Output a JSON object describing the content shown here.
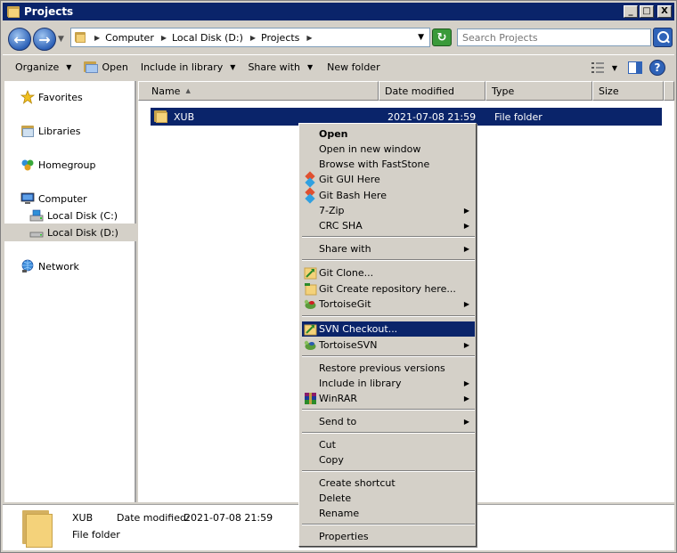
{
  "window": {
    "title": "Projects"
  },
  "titlebar_buttons": {
    "minimize": "_",
    "maximize": "□",
    "close": "X"
  },
  "address": {
    "crumbs": [
      "Computer",
      "Local Disk (D:)",
      "Projects"
    ],
    "search_placeholder": "Search Projects"
  },
  "toolbar": {
    "organize": "Organize",
    "open": "Open",
    "include_in_library": "Include in library",
    "share_with": "Share with",
    "new_folder": "New folder"
  },
  "nav": {
    "favorites": "Favorites",
    "libraries": "Libraries",
    "homegroup": "Homegroup",
    "computer": "Computer",
    "local_c": "Local Disk (C:)",
    "local_d": "Local Disk (D:)",
    "network": "Network"
  },
  "columns": {
    "name": "Name",
    "date_modified": "Date modified",
    "type": "Type",
    "size": "Size"
  },
  "files": [
    {
      "name": "XUB",
      "date": "2021-07-08 21:59",
      "type": "File folder"
    }
  ],
  "details": {
    "name": "XUB",
    "date_label": "Date modified:",
    "date_value": "2021-07-08 21:59",
    "type": "File folder"
  },
  "context_menu": {
    "open": "Open",
    "open_new_window": "Open in new window",
    "browse_faststone": "Browse with FastStone",
    "git_gui": "Git GUI Here",
    "git_bash": "Git Bash Here",
    "seven_zip": "7-Zip",
    "crc_sha": "CRC SHA",
    "share_with": "Share with",
    "git_clone": "Git Clone...",
    "git_create": "Git Create repository here...",
    "tortoise_git": "TortoiseGit",
    "svn_checkout": "SVN Checkout...",
    "tortoise_svn": "TortoiseSVN",
    "restore_versions": "Restore previous versions",
    "include_library": "Include in library",
    "winrar": "WinRAR",
    "send_to": "Send to",
    "cut": "Cut",
    "copy": "Copy",
    "create_shortcut": "Create shortcut",
    "delete": "Delete",
    "rename": "Rename",
    "properties": "Properties"
  },
  "colors": {
    "selection": "#0a246a",
    "chrome": "#d4d0c8",
    "folder": "#f4d27a"
  }
}
